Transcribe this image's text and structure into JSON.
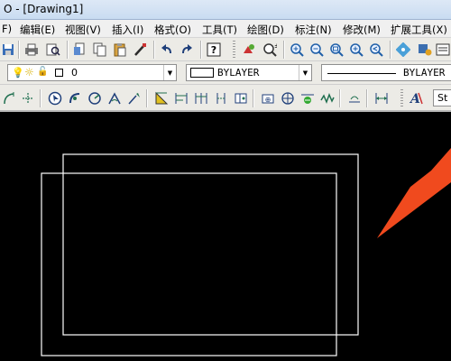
{
  "window": {
    "title": "O - [Drawing1]"
  },
  "menu": [
    {
      "id": "file",
      "label": "F)"
    },
    {
      "id": "edit",
      "label": "编辑(E)"
    },
    {
      "id": "view",
      "label": "视图(V)"
    },
    {
      "id": "insert",
      "label": "插入(I)"
    },
    {
      "id": "format",
      "label": "格式(O)"
    },
    {
      "id": "tools",
      "label": "工具(T)"
    },
    {
      "id": "draw",
      "label": "绘图(D)"
    },
    {
      "id": "dimension",
      "label": "标注(N)"
    },
    {
      "id": "modify",
      "label": "修改(M)"
    },
    {
      "id": "express",
      "label": "扩展工具(X)"
    }
  ],
  "layer": {
    "current": "0"
  },
  "properties": {
    "color": "BYLAYER",
    "linetype": "BYLAYER"
  },
  "style": {
    "label": "St"
  },
  "colors": {
    "canvas": "#000000",
    "drawing_lines": "#ffffff",
    "arrow": "#f04a1e"
  },
  "icons": {
    "standard": [
      "save-icon",
      "print-icon",
      "print-preview-icon",
      "cut-icon",
      "copy-icon",
      "paste-icon",
      "match-properties-icon",
      "undo-icon",
      "redo-icon",
      "help-icon",
      "pan-icon",
      "realtime-zoom-icon",
      "zoom-in-icon",
      "zoom-out-icon",
      "zoom-window-icon",
      "zoom-extents-icon",
      "zoom-previous-icon",
      "tool-palette-icon",
      "design-center-icon"
    ],
    "dimension": [
      "linear-dim-icon",
      "aligned-dim-icon",
      "select-icon",
      "arc-length-icon",
      "radius-icon",
      "angular-icon",
      "leader-icon",
      "quick-dim-icon",
      "baseline-icon",
      "continue-icon",
      "ordinate-icon",
      "tolerance-icon",
      "center-mark-icon",
      "inspect-icon",
      "jogged-icon",
      "dim-edit-icon",
      "dim-text-edit-icon",
      "dim-update-icon",
      "dim-style-icon"
    ]
  }
}
